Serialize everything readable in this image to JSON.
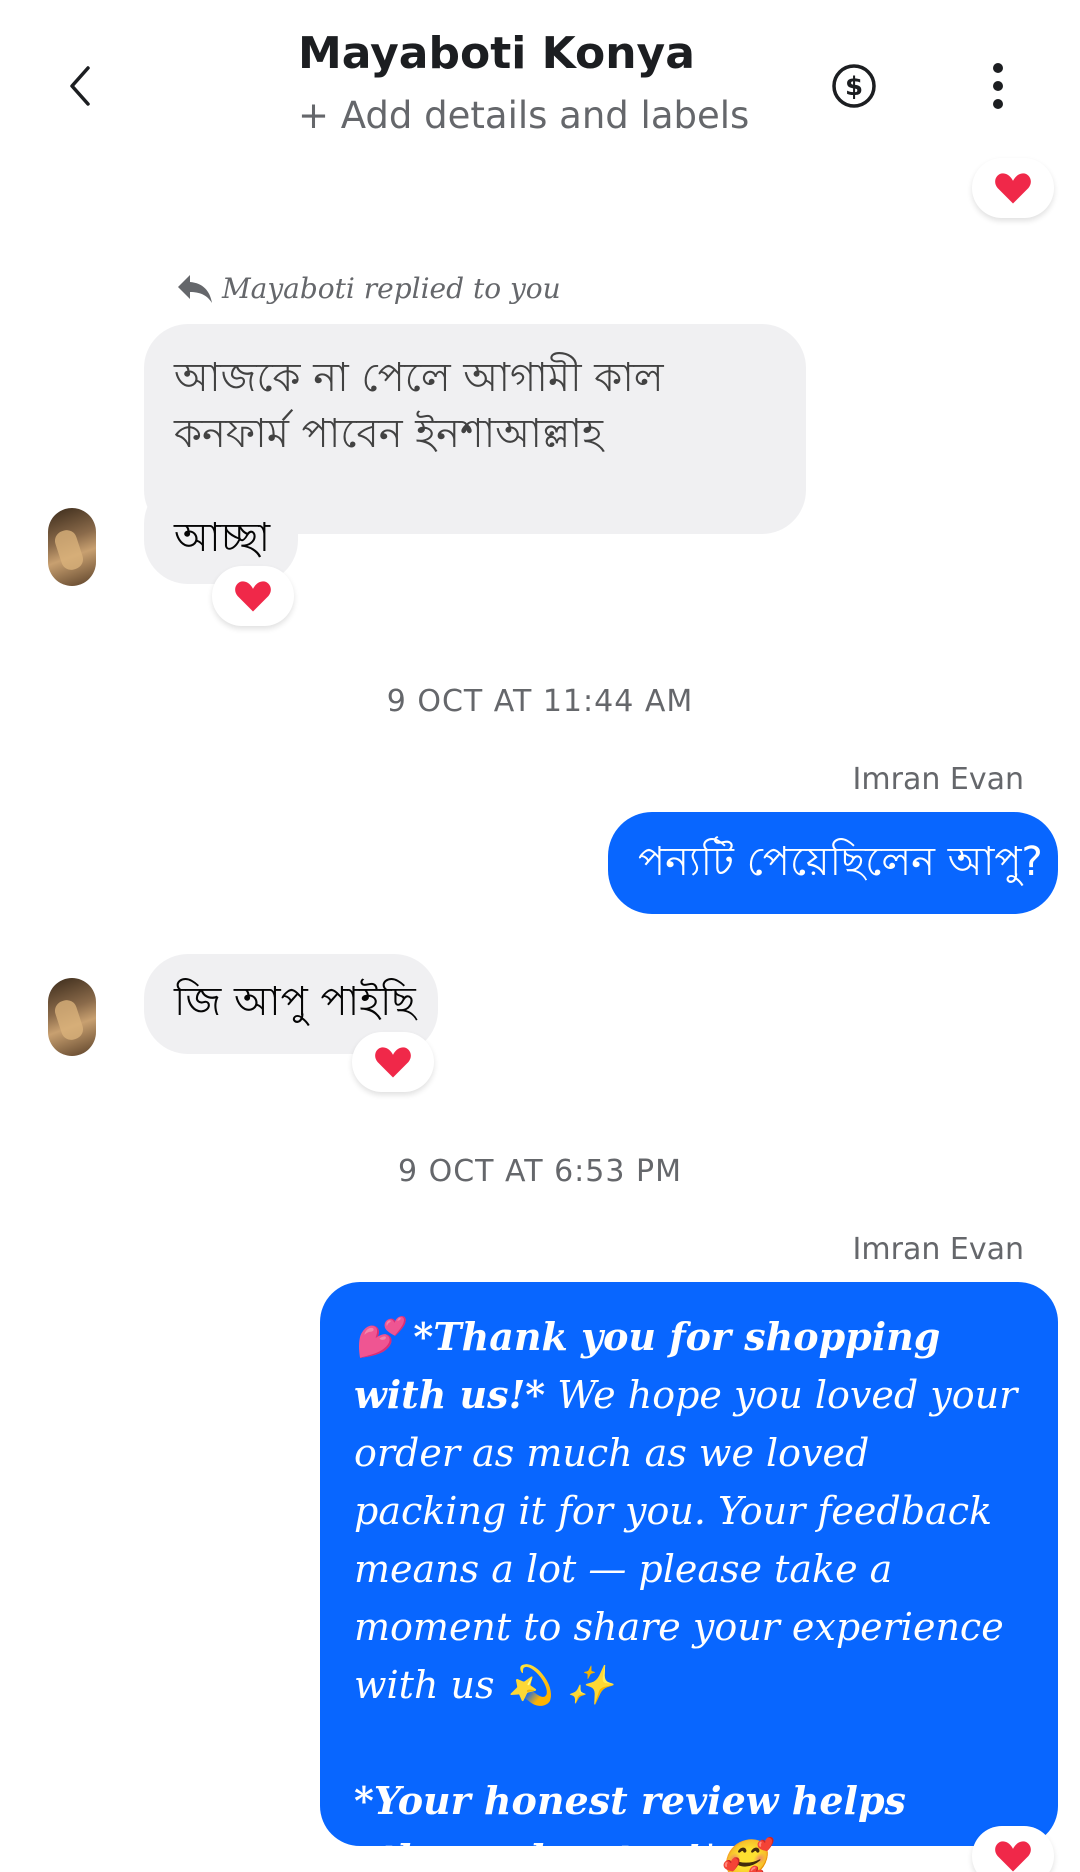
{
  "header": {
    "title": "Mayaboti Konya",
    "subtitle": "+ Add details and labels"
  },
  "reply_indicator": "Mayaboti replied to you",
  "messages": {
    "m1_reply": "আজকে না পেলে আগামী কাল কনফার্ম পাবেন ইনশাআল্লাহ",
    "m1_text": "আচ্ছা",
    "ts1": "9 OCT AT 11:44 AM",
    "sender1": "Imran Evan",
    "m2_text": "পন্যটি পেয়েছিলেন আপু?",
    "m3_text": "জি আপু পাইছি",
    "ts2": "9 OCT AT 6:53 PM",
    "sender2": "Imran Evan",
    "m4_bold": "*Thank you for shopping with us!*",
    "m4_body": " We hope you loved your order as much as we loved packing it for you. Your feedback means a lot — please take a moment to share your experience with us 💫 ✨",
    "m4_footer": "*Your honest review helps others glow too!*🥰",
    "m4_emoji": "💕"
  },
  "reactions": {
    "emoji": "❤️"
  },
  "colors": {
    "outgoing": "#0866ff",
    "incoming": "#f0f0f2",
    "heart": "#f02849"
  }
}
